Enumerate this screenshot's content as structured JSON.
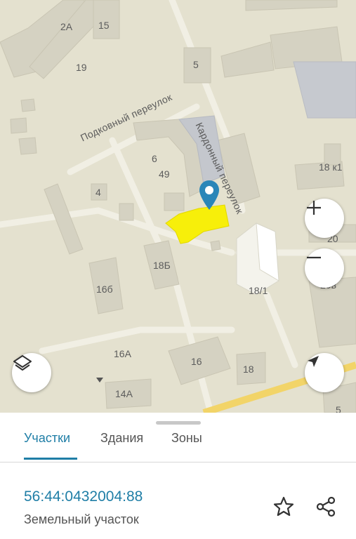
{
  "map": {
    "streets": [
      "Подковный переулок",
      "Кардонный переулок"
    ],
    "labels": {
      "b2a": "2А",
      "b15": "15",
      "b19": "19",
      "b5": "5",
      "b6": "6",
      "b49": "49",
      "b4": "4",
      "b18k1": "18 к1",
      "b20": "20",
      "b18b": "18Б",
      "b16b": "16б",
      "b18_1": "18/1",
      "b20v": "20в",
      "b16a": "16А",
      "b16": "16",
      "b18": "18",
      "b14a": "14А",
      "b5b": "5"
    },
    "icons": [
      "map-pin-icon",
      "zoom-in-icon",
      "zoom-out-icon",
      "layers-icon",
      "navigation-arrow-icon"
    ],
    "highlight_color": "#f7ef0a",
    "pin_color": "#2a86b8"
  },
  "tabs": [
    {
      "label": "Участки",
      "active": true
    },
    {
      "label": "Здания",
      "active": false
    },
    {
      "label": "Зоны",
      "active": false
    }
  ],
  "parcel": {
    "cadastral_number": "56:44:0432004:88",
    "type": "Земельный участок"
  },
  "actions": [
    "star-icon",
    "share-icon"
  ],
  "colors": {
    "accent": "#1f7ea6",
    "map_bg": "#e4e1cf",
    "building": "#d6d3c3"
  }
}
